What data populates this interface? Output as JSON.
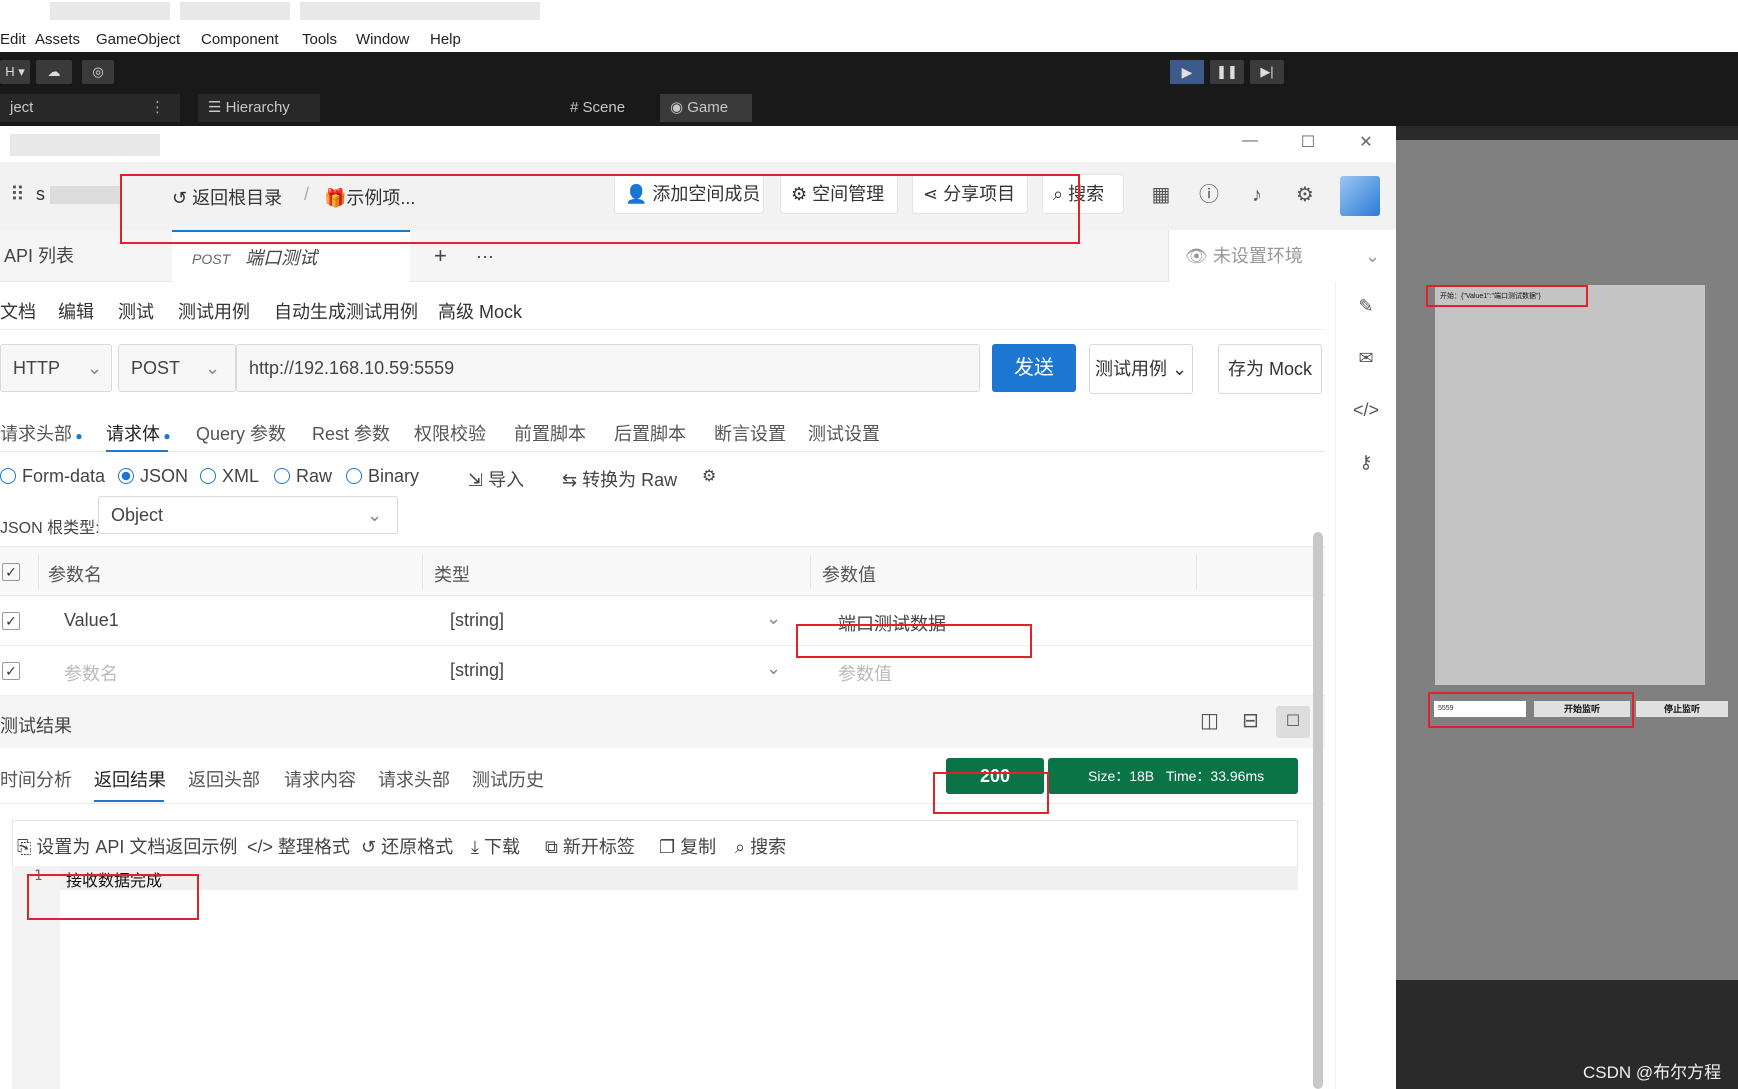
{
  "unity": {
    "menu": [
      "Edit",
      "Assets",
      "GameObject",
      "Component",
      "Tools",
      "Window",
      "Help"
    ],
    "toolbar_left": "H",
    "tabs": [
      "ject",
      "Hierarchy",
      "Scene",
      "Game"
    ],
    "game_view": {
      "label_text": "开始：{\"Value1\":\"端口测试数据\"}",
      "port_input": "5559",
      "start_button": "开始监听",
      "stop_button": "停止监听"
    },
    "watermark": "CSDN @布尔方程"
  },
  "apifox": {
    "header": {
      "workspace": "s",
      "back_root": "返回根目录",
      "project": "🎁示例项...",
      "add_member": "添加空间成员",
      "space_manage": "空间管理",
      "share_project": "分享项目",
      "search": "搜索"
    },
    "tabs": {
      "api_list": "API 列表",
      "active_method": "POST",
      "active_title": "端口测试",
      "add": "+",
      "more": "···",
      "environment": "未设置环境"
    },
    "subnav": [
      "文档",
      "编辑",
      "测试",
      "测试用例",
      "自动生成测试用例",
      "高级 Mock"
    ],
    "request": {
      "protocol": "HTTP",
      "method": "POST",
      "url": "http://192.168.10.59:5559",
      "send": "发送",
      "test_case": "测试用例",
      "save_mock": "存为 Mock"
    },
    "param_tabs": [
      "请求头部",
      "请求体",
      "Query 参数",
      "Rest 参数",
      "权限校验",
      "前置脚本",
      "后置脚本",
      "断言设置",
      "测试设置"
    ],
    "body_types": [
      "Form-data",
      "JSON",
      "XML",
      "Raw",
      "Binary"
    ],
    "body_actions": [
      "导入",
      "转换为 Raw"
    ],
    "json_root_label": "JSON 根类型:",
    "json_root_value": "Object",
    "table": {
      "headers": [
        "参数名",
        "类型",
        "参数值"
      ],
      "rows": [
        {
          "name": "Value1",
          "type": "[string]",
          "value": "端口测试数据"
        },
        {
          "name": "参数名",
          "type": "[string]",
          "value": "参数值"
        }
      ]
    },
    "result": {
      "title": "测试结果",
      "tabs": [
        "时间分析",
        "返回结果",
        "返回头部",
        "请求内容",
        "请求头部",
        "测试历史"
      ],
      "status_code": "200",
      "size": "Size：18B",
      "time": "Time：33.96ms",
      "tools": [
        "设置为 API 文档返回示例",
        "整理格式",
        "还原格式",
        "下载",
        "新开标签",
        "复制",
        "搜索"
      ],
      "line_number": "1",
      "body": "接收数据完成"
    }
  }
}
